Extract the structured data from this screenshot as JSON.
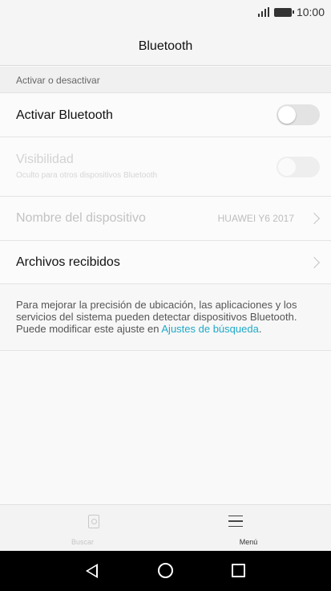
{
  "status_bar": {
    "time": "10:00"
  },
  "header": {
    "title": "Bluetooth"
  },
  "section": {
    "label": "Activar o desactivar"
  },
  "settings": {
    "bluetooth": {
      "label": "Activar Bluetooth",
      "enabled": false
    },
    "visibility": {
      "label": "Visibilidad",
      "sublabel": "Oculto para otros dispositivos Bluetooth",
      "enabled": false,
      "disabled": true
    },
    "device_name": {
      "label": "Nombre del dispositivo",
      "value": "HUAWEI Y6 2017"
    },
    "received_files": {
      "label": "Archivos recibidos"
    }
  },
  "info": {
    "text": "Para mejorar la precisión de ubicación, las aplicaciones y los servicios del sistema pueden detectar dispositivos Bluetooth. Puede modificar este ajuste en ",
    "link": "Ajustes de búsqueda",
    "suffix": "."
  },
  "bottom_nav": {
    "search_label": "Buscar",
    "menu_label": "Menú"
  },
  "colors": {
    "accent": "#1fa9c8",
    "toggle_off": "#e3e3e3",
    "system_nav": "#000000"
  },
  "icons": [
    "signal-icon",
    "battery-icon",
    "chevron-right-icon",
    "search-icon",
    "menu-icon",
    "back-icon",
    "home-icon",
    "recents-icon"
  ]
}
